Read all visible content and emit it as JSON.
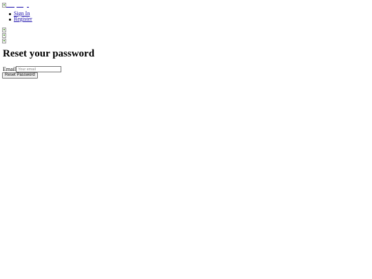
{
  "header": {
    "logo_icon": "broken-image-icon"
  },
  "nav": {
    "items": [
      {
        "label": "Sign In"
      },
      {
        "label": "Register"
      }
    ]
  },
  "images": {
    "icons": [
      "broken-image-icon",
      "broken-image-icon",
      "broken-image-icon"
    ]
  },
  "main": {
    "title": "Reset your password",
    "email_label": "Email",
    "email_placeholder": "Your email",
    "email_value": "",
    "submit_label": "Reset Password"
  },
  "colors": {
    "link": "#1a0dab",
    "button_bg": "#efefef"
  }
}
